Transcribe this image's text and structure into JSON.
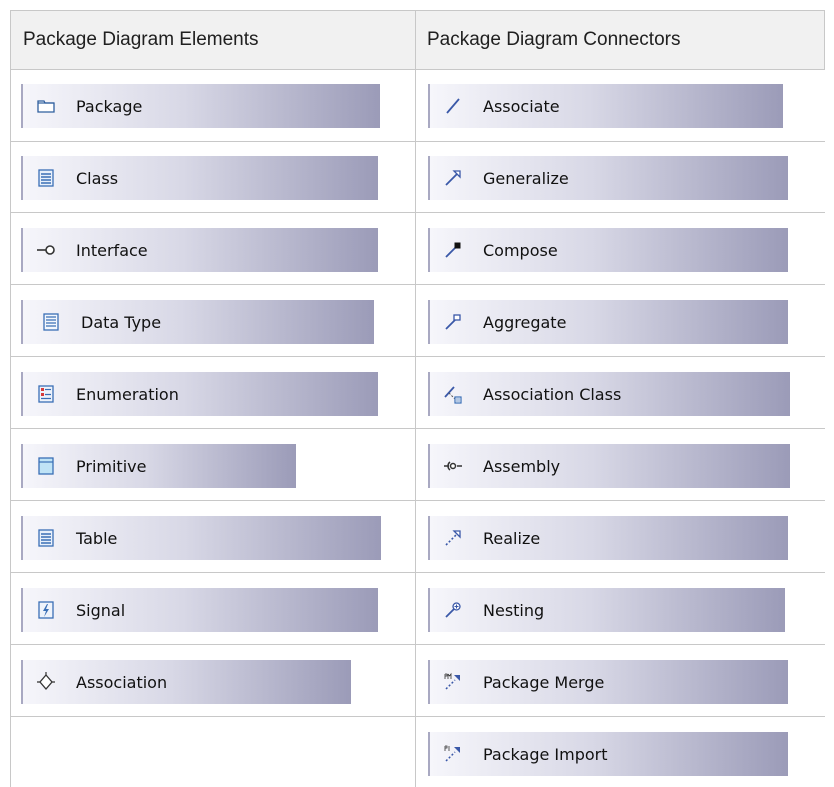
{
  "header": {
    "elements_title": "Package Diagram Elements",
    "connectors_title": "Package Diagram Connectors"
  },
  "elements": [
    {
      "label": "Package",
      "icon": "package-icon"
    },
    {
      "label": "Class",
      "icon": "class-icon"
    },
    {
      "label": "Interface",
      "icon": "interface-icon"
    },
    {
      "label": "Data Type",
      "icon": "data-type-icon"
    },
    {
      "label": "Enumeration",
      "icon": "enumeration-icon"
    },
    {
      "label": "Primitive",
      "icon": "primitive-icon"
    },
    {
      "label": "Table",
      "icon": "table-icon"
    },
    {
      "label": "Signal",
      "icon": "signal-icon"
    },
    {
      "label": "Association",
      "icon": "association-icon"
    }
  ],
  "connectors": [
    {
      "label": "Associate",
      "icon": "associate-icon"
    },
    {
      "label": "Generalize",
      "icon": "generalize-icon"
    },
    {
      "label": "Compose",
      "icon": "compose-icon"
    },
    {
      "label": "Aggregate",
      "icon": "aggregate-icon"
    },
    {
      "label": "Association Class",
      "icon": "association-class-icon"
    },
    {
      "label": "Assembly",
      "icon": "assembly-icon"
    },
    {
      "label": "Realize",
      "icon": "realize-icon"
    },
    {
      "label": "Nesting",
      "icon": "nesting-icon"
    },
    {
      "label": "Package Merge",
      "icon": "package-merge-icon"
    },
    {
      "label": "Package Import",
      "icon": "package-import-icon"
    }
  ],
  "colors": {
    "border": "#c8c8c8",
    "header_bg": "#f1f1f1",
    "tool_gradient_start": "#f6f6fb",
    "tool_gradient_end": "#9b9bb8",
    "icon_blue": "#3a6fb6"
  }
}
